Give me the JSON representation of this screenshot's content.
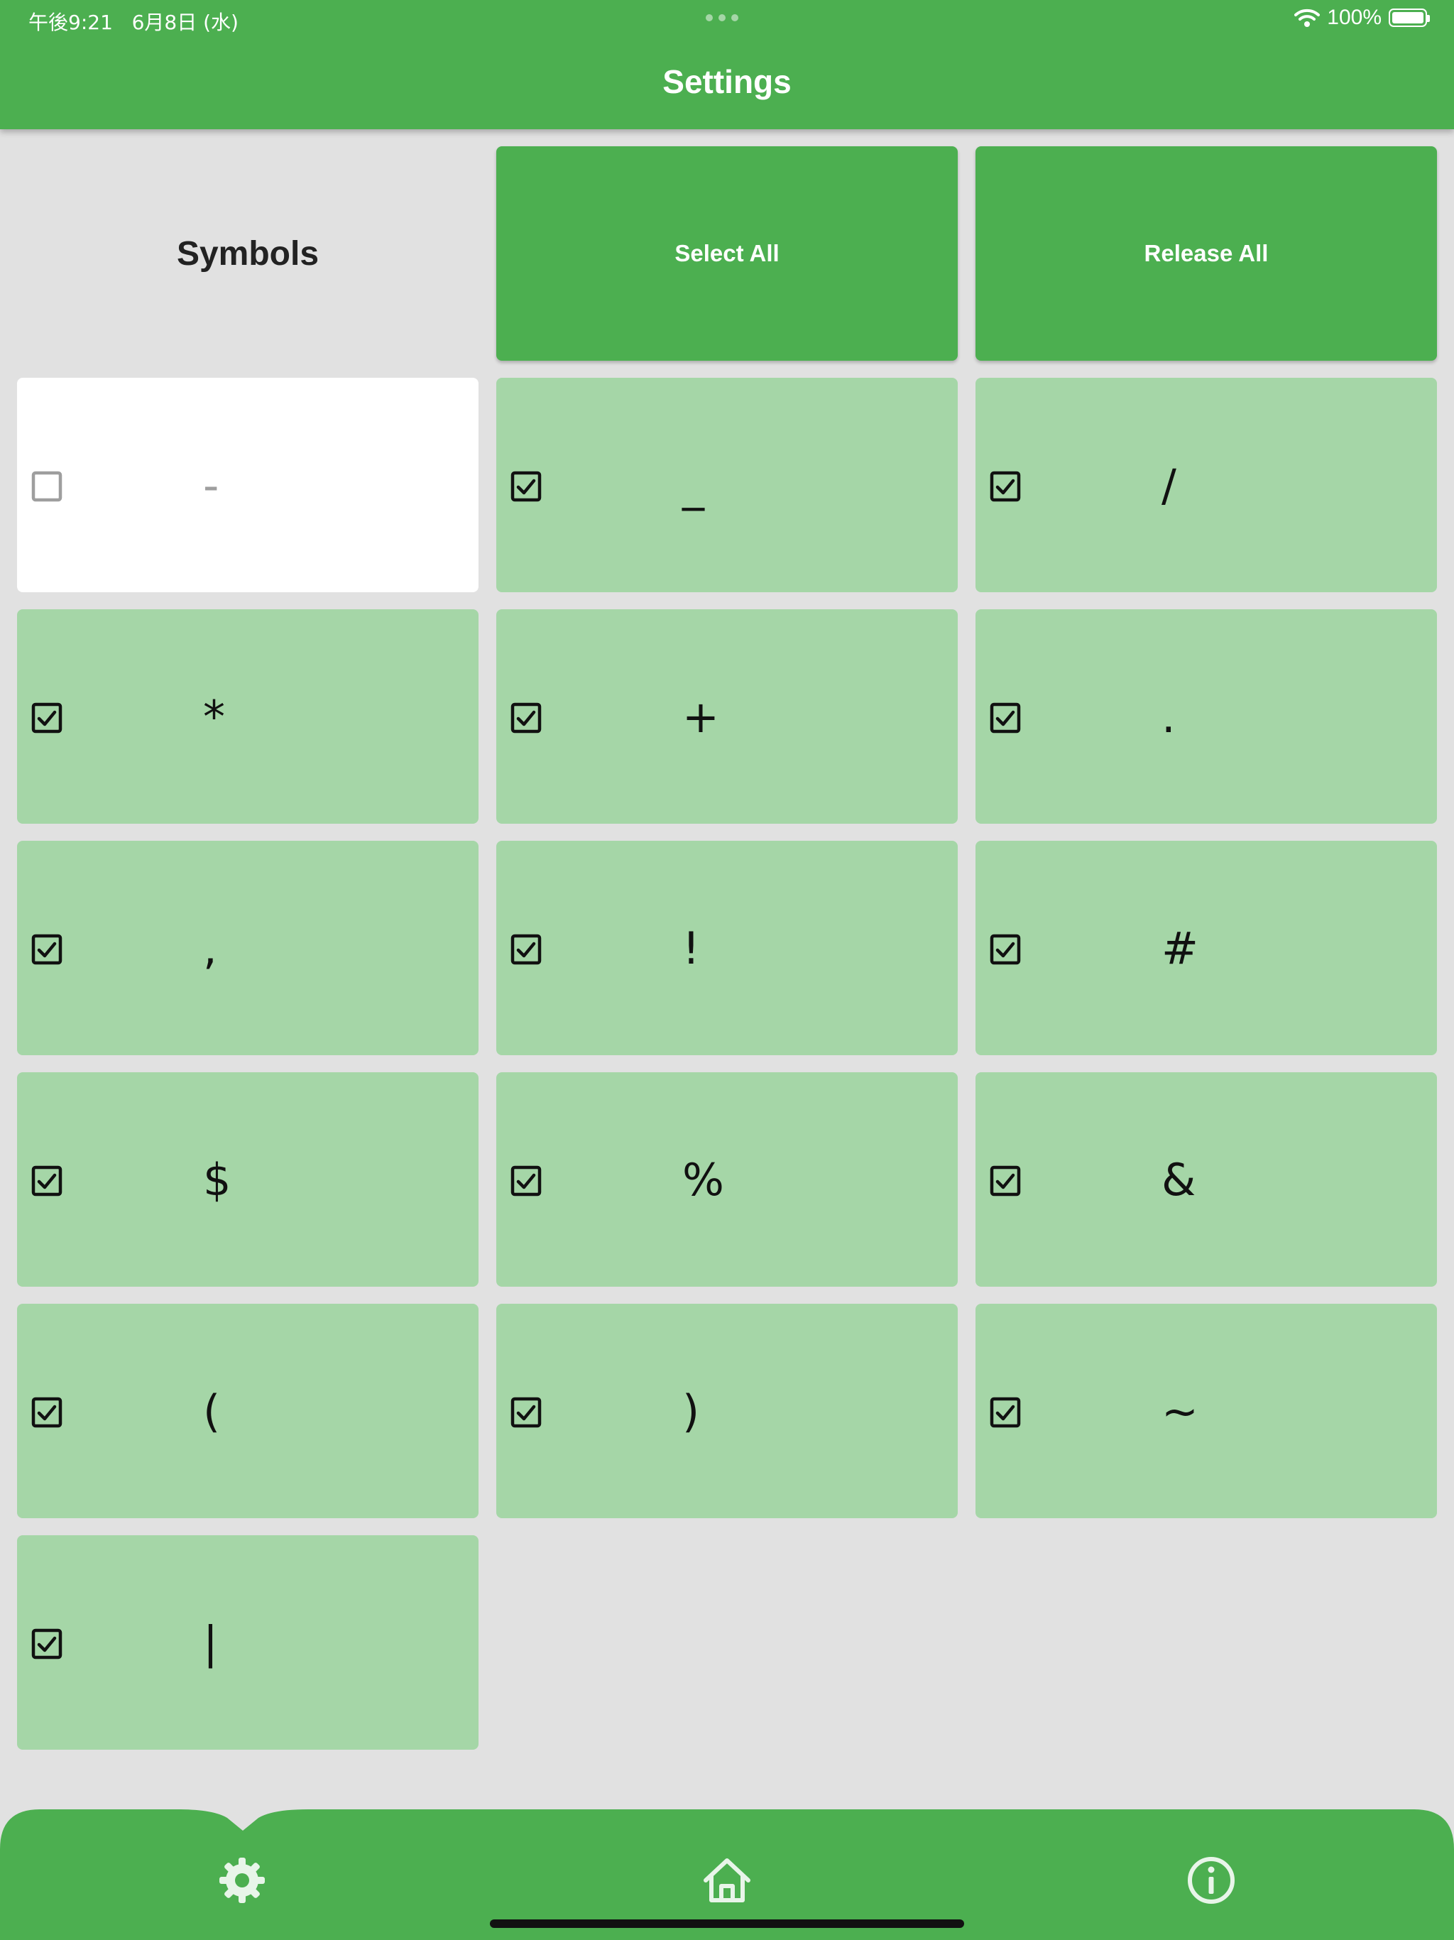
{
  "status_bar": {
    "time_date": "午後9:21   6月8日 (水)",
    "battery": "100%"
  },
  "header": {
    "title": "Settings"
  },
  "controls": {
    "section_label": "Symbols",
    "select_all": "Select All",
    "release_all": "Release All"
  },
  "symbols": [
    {
      "symbol": "-",
      "checked": false
    },
    {
      "symbol": "_",
      "checked": true
    },
    {
      "symbol": "/",
      "checked": true
    },
    {
      "symbol": "*",
      "checked": true
    },
    {
      "symbol": "+",
      "checked": true
    },
    {
      "symbol": ".",
      "checked": true
    },
    {
      "symbol": ",",
      "checked": true
    },
    {
      "symbol": "!",
      "checked": true
    },
    {
      "symbol": "#",
      "checked": true
    },
    {
      "symbol": "$",
      "checked": true
    },
    {
      "symbol": "%",
      "checked": true
    },
    {
      "symbol": "&",
      "checked": true
    },
    {
      "symbol": "(",
      "checked": true
    },
    {
      "symbol": ")",
      "checked": true
    },
    {
      "symbol": "~",
      "checked": true
    },
    {
      "symbol": "|",
      "checked": true
    }
  ],
  "bottom_nav": {
    "items": [
      {
        "icon": "gear-icon",
        "selected": true
      },
      {
        "icon": "home-icon",
        "selected": false
      },
      {
        "icon": "info-icon",
        "selected": false
      }
    ]
  },
  "colors": {
    "primary": "#4CAF50",
    "item_checked": "#A5D6A7",
    "item_unchecked": "#FFFFFF",
    "background": "#E1E1E1",
    "icon_light": "#E8F5E9"
  }
}
